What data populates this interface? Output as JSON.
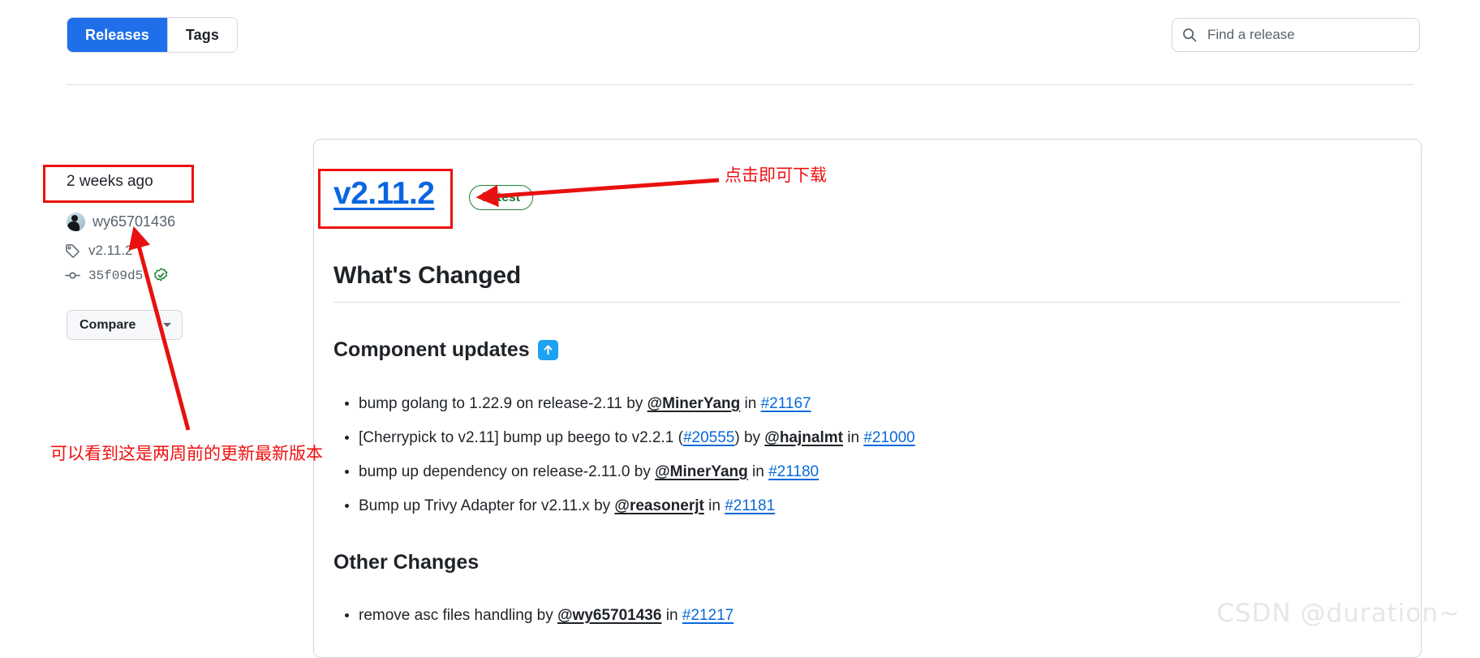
{
  "header": {
    "tabs": [
      {
        "label": "Releases",
        "active": true
      },
      {
        "label": "Tags",
        "active": false
      }
    ],
    "search": {
      "placeholder": "Find a release",
      "value": "",
      "icon": "search-icon"
    }
  },
  "sidebar": {
    "date": "2 weeks ago",
    "author": "wy65701436",
    "tag": "v2.11.2",
    "commit": "35f09d5",
    "verified_icon": "verified-check-icon",
    "tag_icon": "tag-icon",
    "commit_icon": "commit-icon",
    "compare_label": "Compare"
  },
  "release": {
    "version": "v2.11.2",
    "latest_badge": "Latest",
    "whats_changed_title": "What's Changed",
    "sections": [
      {
        "id": "component-updates",
        "title": "Component updates",
        "emoji": "arrow-up-emoji",
        "items": [
          {
            "pre": "bump golang to 1.22.9 on release-2.11 by ",
            "user": "@MinerYang",
            "mid": " in ",
            "pr": "#21167",
            "post": ""
          },
          {
            "pre": "[Cherrypick to v2.11] bump up beego to v2.2.1 (",
            "inline_pr": "#20555",
            "pre2": ") by ",
            "user": "@hajnalmt",
            "mid": " in ",
            "pr": "#21000",
            "post": ""
          },
          {
            "pre": "bump up dependency on release-2.11.0 by ",
            "user": "@MinerYang",
            "mid": " in ",
            "pr": "#21180",
            "post": ""
          },
          {
            "pre": "Bump up Trivy Adapter for v2.11.x by ",
            "user": "@reasonerjt",
            "mid": " in ",
            "pr": "#21181",
            "post": ""
          }
        ]
      },
      {
        "id": "other-changes",
        "title": "Other Changes",
        "emoji": "",
        "items": [
          {
            "pre": "remove asc files handling by ",
            "user": "@wy65701436",
            "mid": " in ",
            "pr": "#21217",
            "post": ""
          }
        ]
      }
    ]
  },
  "annotations": {
    "download_note": "点击即可下载",
    "twoweeks_note": "可以看到这是两周前的更新最新版本",
    "highlight_color": "#ee1111",
    "arrow_color": "#e81010"
  },
  "watermark": "CSDN @duration~",
  "colors": {
    "accent_blue": "#1f6feb",
    "link_blue": "#0969da",
    "version_blue": "#0a66e0",
    "green": "#1a7f37",
    "border": "#d1d9e0",
    "muted_text": "#59636e"
  }
}
